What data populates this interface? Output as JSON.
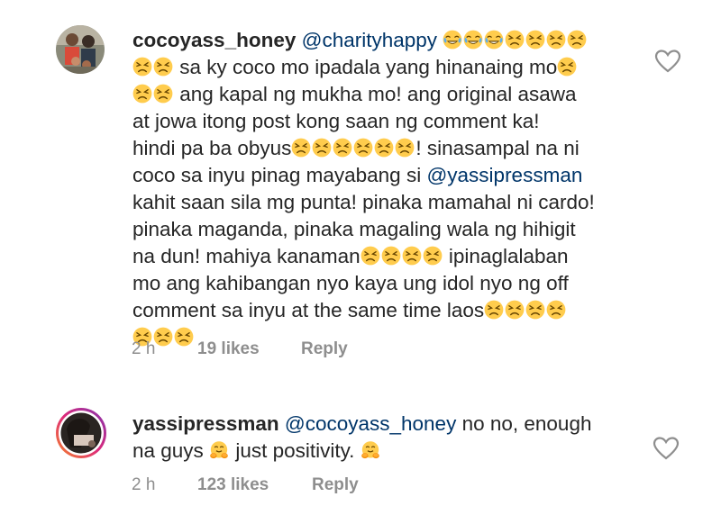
{
  "comments": [
    {
      "username": "cocoyass_honey",
      "lines": [
        [
          {
            "t": "user",
            "v": "cocoyass_honey"
          },
          {
            "t": "text",
            "v": " "
          },
          {
            "t": "mention",
            "v": "@charityhappy"
          },
          {
            "t": "text",
            "v": " "
          },
          {
            "t": "emo",
            "v": "joy"
          },
          {
            "t": "emo",
            "v": "joy"
          },
          {
            "t": "emo",
            "v": "joy"
          },
          {
            "t": "emo",
            "v": "persevere"
          },
          {
            "t": "emo",
            "v": "persevere"
          },
          {
            "t": "emo",
            "v": "persevere"
          },
          {
            "t": "emo",
            "v": "persevere"
          }
        ],
        [
          {
            "t": "emo",
            "v": "persevere"
          },
          {
            "t": "emo",
            "v": "persevere"
          },
          {
            "t": "text",
            "v": " sa ky coco mo ipadala yang hinanaing mo"
          },
          {
            "t": "emo",
            "v": "persevere"
          }
        ],
        [
          {
            "t": "emo",
            "v": "persevere"
          },
          {
            "t": "emo",
            "v": "persevere"
          },
          {
            "t": "text",
            "v": " ang kapal ng mukha mo! ang original asawa"
          }
        ],
        [
          {
            "t": "text",
            "v": "at jowa  itong  post kong saan ng comment ka!"
          }
        ],
        [
          {
            "t": "text",
            "v": "hindi pa ba obyus"
          },
          {
            "t": "emo",
            "v": "persevere"
          },
          {
            "t": "emo",
            "v": "persevere"
          },
          {
            "t": "emo",
            "v": "persevere"
          },
          {
            "t": "emo",
            "v": "persevere"
          },
          {
            "t": "emo",
            "v": "persevere"
          },
          {
            "t": "emo",
            "v": "persevere"
          },
          {
            "t": "text",
            "v": "! sinasampal na ni"
          }
        ],
        [
          {
            "t": "text",
            "v": "coco sa inyu pinag mayabang si "
          },
          {
            "t": "mention",
            "v": "@yassipressman"
          }
        ],
        [
          {
            "t": "text",
            "v": "kahit saan sila mg punta! pinaka mamahal ni cardo!"
          }
        ],
        [
          {
            "t": "text",
            "v": "pinaka maganda, pinaka  magaling  wala ng hihigit"
          }
        ],
        [
          {
            "t": "text",
            "v": "na dun!  mahiya kanaman"
          },
          {
            "t": "emo",
            "v": "persevere"
          },
          {
            "t": "emo",
            "v": "persevere"
          },
          {
            "t": "emo",
            "v": "persevere"
          },
          {
            "t": "emo",
            "v": "persevere"
          },
          {
            "t": "text",
            "v": " ipinaglalaban"
          }
        ],
        [
          {
            "t": "text",
            "v": "mo ang kahibangan nyo kaya ung idol nyo ng off"
          }
        ],
        [
          {
            "t": "text",
            "v": "comment sa inyu at the same time  laos"
          },
          {
            "t": "emo",
            "v": "persevere"
          },
          {
            "t": "emo",
            "v": "persevere"
          },
          {
            "t": "emo",
            "v": "persevere"
          },
          {
            "t": "emo",
            "v": "persevere"
          }
        ],
        [
          {
            "t": "emo",
            "v": "persevere"
          },
          {
            "t": "emo",
            "v": "persevere"
          },
          {
            "t": "emo",
            "v": "persevere"
          }
        ]
      ],
      "time": "2 h",
      "likes": "19 likes",
      "reply": "Reply"
    },
    {
      "username": "yassipressman",
      "lines": [
        [
          {
            "t": "user",
            "v": "yassipressman"
          },
          {
            "t": "text",
            "v": " "
          },
          {
            "t": "mention",
            "v": "@cocoyass_honey"
          },
          {
            "t": "text",
            "v": " no no, enough"
          }
        ],
        [
          {
            "t": "text",
            "v": "na guys "
          },
          {
            "t": "emo",
            "v": "hug"
          },
          {
            "t": "text",
            "v": " just positivity. "
          },
          {
            "t": "emo",
            "v": "hug"
          }
        ]
      ],
      "time": "2 h",
      "likes": "123 likes",
      "reply": "Reply"
    }
  ],
  "icons": {
    "like": "heart-outline-icon"
  },
  "colors": {
    "text": "#262626",
    "mention": "#003569",
    "meta": "#8e8e8e",
    "emoji_face": "#FFCC4D"
  }
}
